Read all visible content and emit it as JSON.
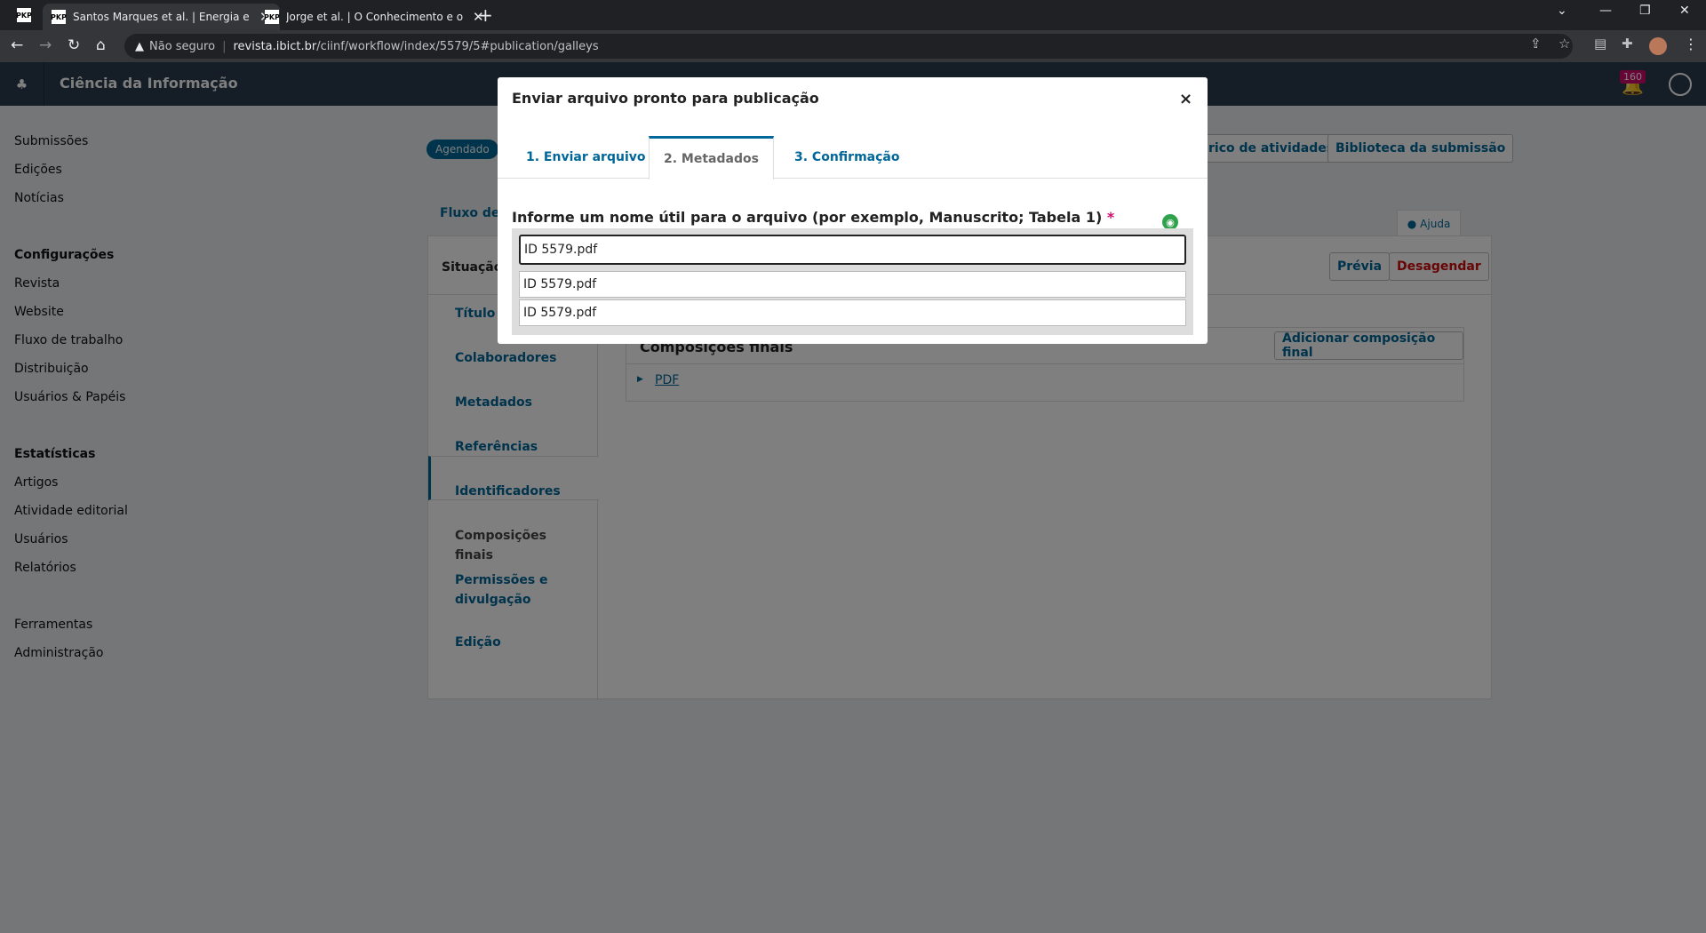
{
  "browser": {
    "tabs": [
      {
        "favicon": "PKP",
        "title": "Santos Marques et al. | Energia e"
      },
      {
        "favicon": "PKP",
        "title": "Jorge et al. | O Conhecimento e o"
      }
    ],
    "first_favicon": "PKP",
    "url_warning": "Não seguro",
    "url_host": "revista.ibict.br",
    "url_path": "/ciinf/workflow/index/5579/5#publication/galleys"
  },
  "app": {
    "name": "Ciência da Informação",
    "notification_count": "160"
  },
  "sidebar": {
    "group1": [
      "Submissões",
      "Edições",
      "Notícias"
    ],
    "config_heading": "Configurações",
    "config_items": [
      "Revista",
      "Website",
      "Fluxo de trabalho",
      "Distribuição",
      "Usuários & Papéis"
    ],
    "stats_heading": "Estatísticas",
    "stats_items": [
      "Artigos",
      "Atividade editorial",
      "Usuários",
      "Relatórios"
    ],
    "tools": [
      "Ferramentas",
      "Administração"
    ]
  },
  "main": {
    "status": "Agendado",
    "activity_btn": "rico de atividades",
    "library_btn": "Biblioteca da submissão",
    "flow_link": "Fluxo de t",
    "help": "Ajuda",
    "situacao": "Situação:",
    "previa": "Prévia",
    "desagendar": "Desagendar",
    "tabs": [
      "Título e",
      "Colaboradores",
      "Metadados",
      "Referências",
      "Identificadores",
      "Composições finais",
      "Permissões e divulgação",
      "Edição"
    ],
    "galleys": {
      "title": "Composições finais",
      "add": "Adicionar composição final",
      "item": "PDF"
    }
  },
  "modal": {
    "title": "Enviar arquivo pronto para publicação",
    "close": "×",
    "tabs": [
      "1. Enviar arquivo",
      "2. Metadados",
      "3. Confirmação"
    ],
    "field_label": "Informe um nome útil para o arquivo (por exemplo, Manuscrito; Tabela 1)",
    "required": "*",
    "value_main": "ID 5579.pdf",
    "value_alt1": "ID 5579.pdf",
    "value_alt2": "ID 5579.pdf"
  }
}
